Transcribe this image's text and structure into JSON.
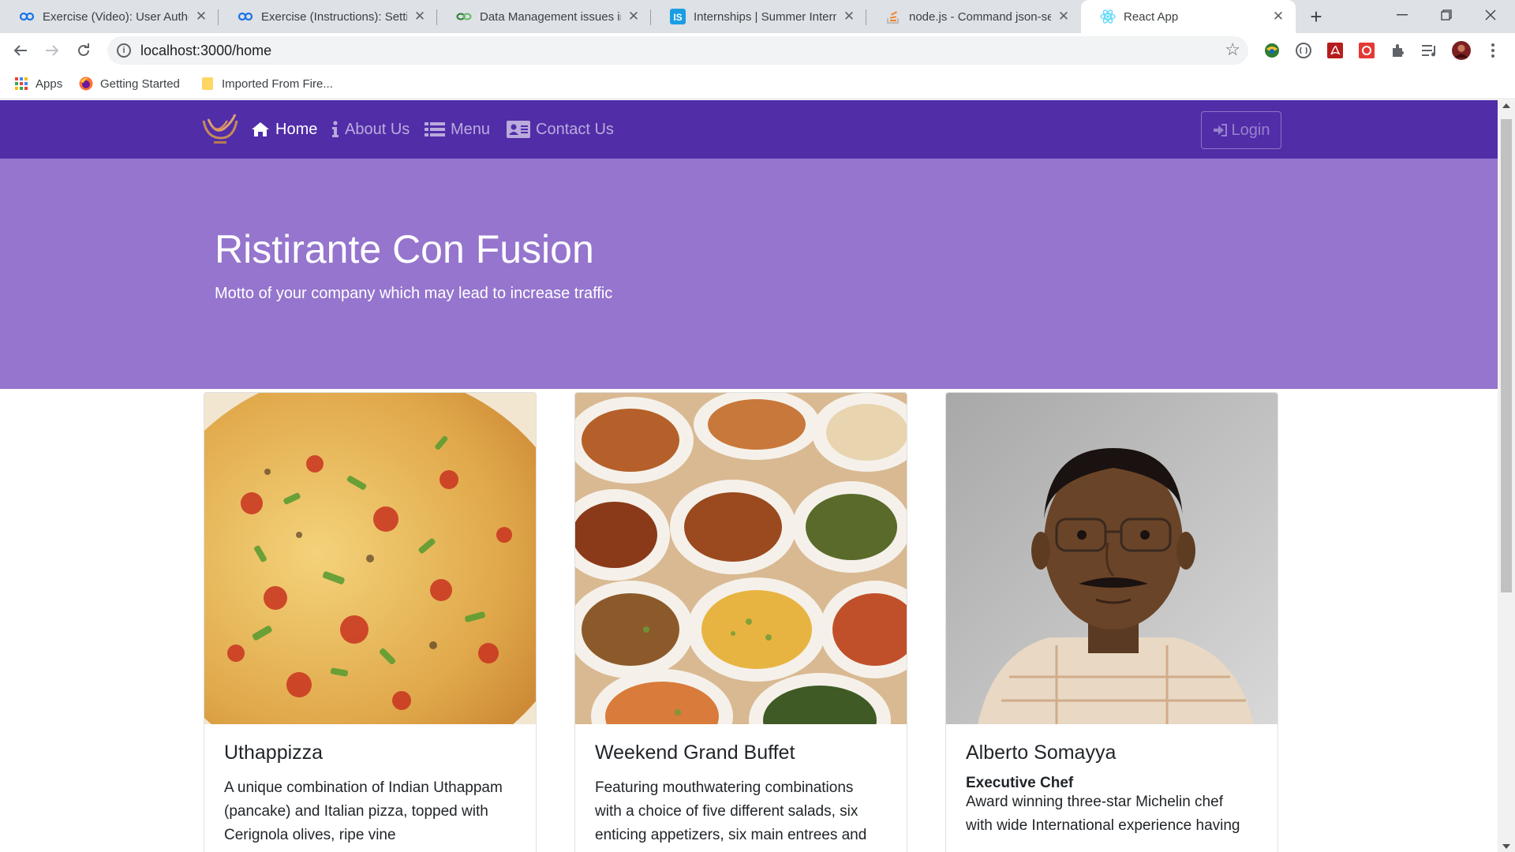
{
  "browser": {
    "tabs": [
      {
        "title": "Exercise (Video): User Authentication",
        "icon": "coursera-icon"
      },
      {
        "title": "Exercise (Instructions): Setting",
        "icon": "coursera-icon"
      },
      {
        "title": "Data Management issues in",
        "icon": "link-icon"
      },
      {
        "title": "Internships | Summer Interns",
        "icon": "internshala-icon"
      },
      {
        "title": "node.js - Command json-server",
        "icon": "stackoverflow-icon"
      },
      {
        "title": "React App",
        "icon": "react-icon"
      }
    ],
    "address": "localhost:3000/home",
    "bookmarks": [
      {
        "label": "Apps",
        "icon": "apps-grid-icon"
      },
      {
        "label": "Getting Started",
        "icon": "firefox-icon"
      },
      {
        "label": "Imported From Fire...",
        "icon": "folder-icon"
      }
    ]
  },
  "site": {
    "nav": {
      "home": "Home",
      "about": "About Us",
      "menu": "Menu",
      "contact": "Contact Us",
      "login": "Login"
    },
    "jumbotron": {
      "title": "Ristirante Con Fusion",
      "motto": "Motto of your company which may lead to increase traffic"
    },
    "cards": [
      {
        "title": "Uthappizza",
        "text": "A unique combination of Indian Uthappam (pancake) and Italian pizza, topped with Cerignola olives, ripe vine"
      },
      {
        "title": "Weekend Grand Buffet",
        "text": "Featuring mouthwatering combinations with a choice of five different salads, six enticing appetizers, six main entrees and"
      },
      {
        "title": "Alberto Somayya",
        "designation": "Executive Chef",
        "text": "Award winning three-star Michelin chef with wide International experience having"
      }
    ]
  },
  "colors": {
    "navbar": "#512da8",
    "jumbotron": "#9575cd"
  }
}
